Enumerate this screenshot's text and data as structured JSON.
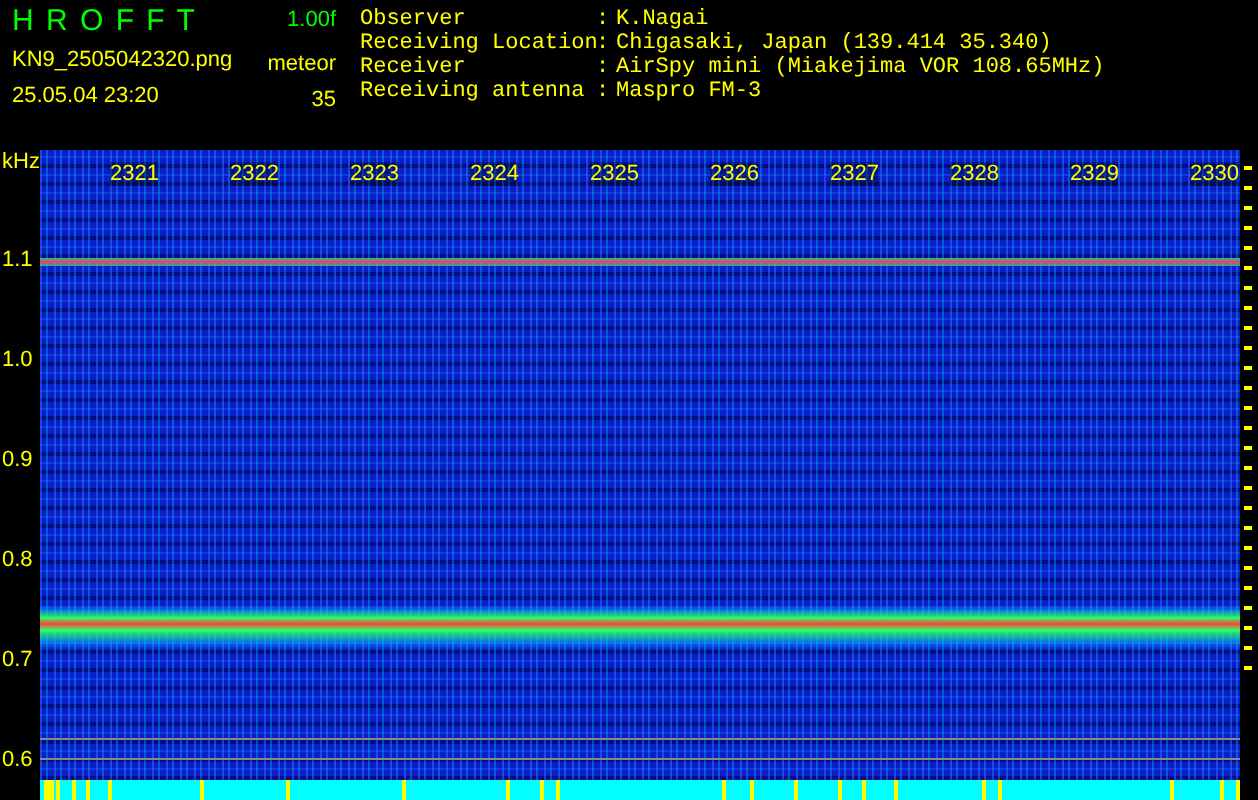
{
  "header": {
    "title": "H R O F F T",
    "version": "1.00f",
    "file_name": "KN9_2505042320.png",
    "mode": "meteor",
    "timestamp": "25.05.04 23:20",
    "count": "35"
  },
  "info": [
    {
      "label": "Observer",
      "separator": ":",
      "value": "K.Nagai"
    },
    {
      "label": "Receiving Location",
      "separator": ":",
      "value": "Chigasaki, Japan (139.414 35.340)"
    },
    {
      "label": "Receiver",
      "separator": ":",
      "value": "AirSpy mini (Miakejima VOR 108.65MHz)"
    },
    {
      "label": "Receiving antenna",
      "separator": ":",
      "value": "Maspro FM-3"
    }
  ],
  "plot": {
    "y_unit": "kHz",
    "y_labels": [
      "1.1",
      "1.0",
      "0.9",
      "0.8",
      "0.7",
      "0.6"
    ],
    "time_labels": [
      "2321",
      "2322",
      "2323",
      "2324",
      "2325",
      "2326",
      "2327",
      "2328",
      "2329",
      "2330"
    ]
  }
}
